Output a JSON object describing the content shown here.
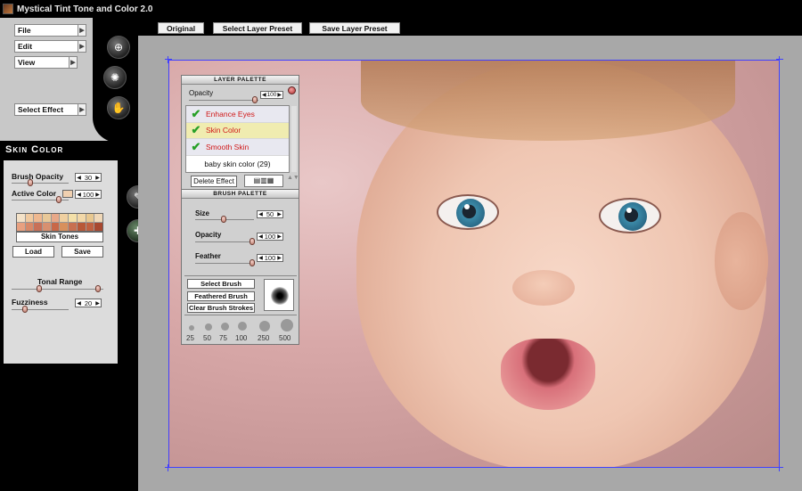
{
  "app": {
    "title": "Mystical Tint Tone and Color 2.0"
  },
  "menu": {
    "file": "File",
    "edit": "Edit",
    "view": "View",
    "select_effect": "Select Effect"
  },
  "top_buttons": {
    "original": "Original",
    "select_preset": "Select Layer Preset",
    "save_preset": "Save Layer Preset"
  },
  "skin_panel": {
    "title": "Skin Color",
    "brush_opacity_label": "Brush Opacity",
    "brush_opacity_value": "30",
    "active_color_label": "Active Color",
    "active_color_value": "100",
    "skin_tones_label": "Skin Tones",
    "load_label": "Load",
    "save_label": "Save",
    "tonal_range_label": "Tonal Range",
    "fuzziness_label": "Fuzziness",
    "fuzziness_value": "20",
    "tones": [
      "#f4e2c8",
      "#f0caa0",
      "#eeb890",
      "#e8c898",
      "#e8a888",
      "#f0d0a0",
      "#f4e0a8",
      "#f2d8a8",
      "#e8c890",
      "#f0d8b8",
      "#e8a080",
      "#d88868",
      "#c87058",
      "#d89070",
      "#c86848",
      "#d8905c",
      "#c87050",
      "#b85838",
      "#c06040",
      "#a84830"
    ]
  },
  "layer_palette": {
    "title": "LAYER PALETTE",
    "opacity_label": "Opacity",
    "opacity_value": "100",
    "layers": [
      {
        "name": "Enhance Eyes"
      },
      {
        "name": "Skin Color"
      },
      {
        "name": "Smooth Skin"
      }
    ],
    "preset_name": "baby skin color (29)",
    "delete_label": "Delete Effect"
  },
  "brush_palette": {
    "title": "BRUSH PALETTE",
    "size_label": "Size",
    "size_value": "50",
    "opacity_label": "Opacity",
    "opacity_value": "100",
    "feather_label": "Feather",
    "feather_value": "100",
    "select_brush": "Select Brush",
    "feathered_brush": "Feathered Brush",
    "clear_strokes": "Clear Brush Strokes",
    "sizes": [
      "25",
      "50",
      "75",
      "100",
      "250",
      "500"
    ]
  }
}
